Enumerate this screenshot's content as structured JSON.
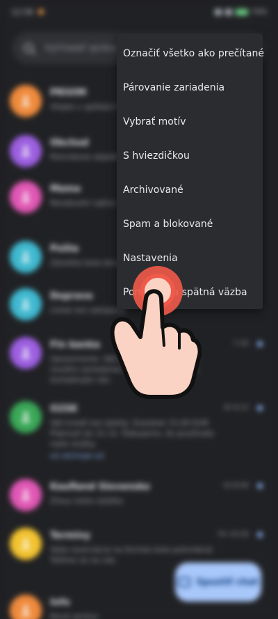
{
  "status_bar": {
    "time": "12:58",
    "battery": "74%"
  },
  "search": {
    "placeholder": "Vyhľadať správy"
  },
  "conversations": [
    {
      "name": "PRIVIM",
      "snippet": "Vitajte v aplikácii Fina",
      "time": "",
      "avatar_color": "#ee8a3c"
    },
    {
      "name": "Obchod",
      "snippet": "Potvrdenie objednávky",
      "time": "",
      "avatar_color": "#9c5fe0"
    },
    {
      "name": "Mama",
      "snippet": "Nezabudni zajtra na stretnutie o deviatej",
      "time": "",
      "avatar_color": "#e057b4"
    },
    {
      "name": "Pošta",
      "snippet": "Zásielka bola doručená",
      "time": "",
      "avatar_color": "#3fb8cf"
    },
    {
      "name": "Doprava",
      "snippet": "Lístok bol zakúpený",
      "time": "",
      "avatar_color": "#3fb8cf"
    },
    {
      "name": "Fin banka",
      "snippet": "Upozornenie: Váš účet bol prihlásený z nového zariadenia. Ak ste to neboli vy, kontaktujte nás.",
      "time": "7:32",
      "avatar_color": "#9c5fe0"
    },
    {
      "name": "O2SK",
      "snippet": "Váš kredit bol dobitý. Zostatok 15,00 EUR. Platnosť do 12.12. Ďakujeme, že používate naše služby.",
      "time": "St 9:12",
      "link": "o2.sk/moje-o2",
      "avatar_color": "#3aa757"
    },
    {
      "name": "Kaufland Slovensko",
      "snippet": "Zľavy tohto týždňa",
      "time": "Ut 8:40",
      "avatar_color": "#e057b4"
    },
    {
      "name": "Terminy",
      "snippet": "Vaša rezervácia na štvrtok bola potvrdená. Tešíme sa na vás.",
      "time": "Po 14:20",
      "avatar_color": "#f2c230"
    },
    {
      "name": "Info",
      "snippet": "Nová správa",
      "time": "",
      "avatar_color": "#ee8a3c"
    }
  ],
  "fab": {
    "label": "Spustiť chat"
  },
  "menu": {
    "items": [
      "Označiť všetko ako prečítané",
      "Párovanie zariadenia",
      "Vybrať motív",
      "S hviezdičkou",
      "Archivované",
      "Spam a blokované",
      "Nastavenia",
      "Pomocník a spätná väzba"
    ]
  },
  "colors": {
    "background": "#202124",
    "menu_bg": "#2b2c30",
    "fab_bg": "#a8c7fa",
    "tap_ring": "#f05a4a",
    "hand_fill": "#fbd3c4"
  }
}
